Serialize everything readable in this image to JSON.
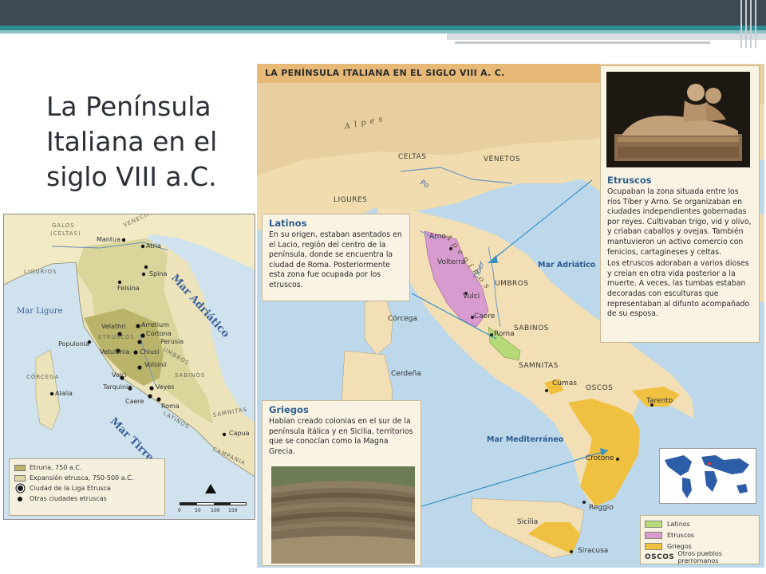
{
  "slide": {
    "title": "La Península Italiana en el siglo VIII a.C."
  },
  "colors": {
    "header_bar": "#3d4a55",
    "accent_teal": "#2f8c93",
    "title_text": "#2b3036"
  },
  "left_map": {
    "seas": {
      "adriatic": "Mar Adriático",
      "tyrrhenian": "Mar Tirreno",
      "ligurian": "Mar Ligure"
    },
    "peoples": {
      "galos": "GALOS",
      "celtas": "(CELTAS)",
      "venecianos": "VENECIANOS",
      "ligurios": "LIGURIOS",
      "etruscos": "ETRUSCOS",
      "umbros": "UMBROS",
      "sabinos": "SABINOS",
      "latinos": "LATINOS",
      "samnitas": "SAMNITAS",
      "campania": "CAMPANIA",
      "corcega": "CÓRCEGA"
    },
    "cities": {
      "mantua": "Mantua",
      "atria": "Atria",
      "spina": "Spina",
      "felsina": "Felsina",
      "arretium": "Arretium",
      "velathri": "Velathri",
      "cortona": "Cortona",
      "perusia": "Perusia",
      "populonia": "Populonia",
      "vetulonia": "Vetulonia",
      "chiusi": "Chiusi",
      "volsinii": "Volsinii",
      "volci": "Volci",
      "tarquinia": "Tarquinia",
      "veyes": "Veyes",
      "caere": "Caere",
      "roma": "Roma",
      "alalia": "Alalia",
      "capua": "Capua"
    },
    "legend": [
      {
        "label": "Etruria, 750 a.C.",
        "color": "#b9b46a"
      },
      {
        "label": "Expansión etrusca, 750-500 a.C.",
        "color": "#dcd9a0"
      },
      {
        "label": "Ciudad de la Liga Etrusca"
      },
      {
        "label": "Otras ciudades etruscas"
      }
    ],
    "scale_ticks": [
      "0",
      "50",
      "100",
      "150"
    ]
  },
  "big_map": {
    "title": "LA PENÍNSULA ITALIANA EN EL SIGLO VIII A. C.",
    "alps": "A l p e s",
    "apeninos": "A p e n i n o s",
    "rivers": {
      "po": "Po",
      "tiber": "Tíber"
    },
    "seas": {
      "adriatic": "Mar Adriático",
      "mediterranean": "Mar Mediterráneo"
    },
    "peoples": {
      "celtas": "CELTAS",
      "venetos": "VÉNETOS",
      "ligures": "LIGURES",
      "umbros": "UMBROS",
      "sabinos": "SABINOS",
      "samnitas": "SAMNITAS",
      "oscos": "OSCOS"
    },
    "places": {
      "arno": "Arno",
      "volterra": "Volterra",
      "vulci": "Vulci",
      "caere": "Caere",
      "roma": "Roma",
      "corcega": "Córcega",
      "cerdena": "Cerdeña",
      "cumas": "Cumas",
      "tarento": "Tarento",
      "crotone": "Crotone",
      "reggio": "Reggio",
      "sicilia": "Sicilia",
      "siracusa": "Siracusa"
    },
    "latinos_box": {
      "heading": "Latinos",
      "text": "En su origen, estaban asentados en el Lacio, región del centro de la península, donde se encuentra la ciudad de Roma. Posteriormente esta zona fue ocupada por los etruscos."
    },
    "etruscos_box": {
      "heading": "Etruscos",
      "text1": "Ocupaban la zona situada entre los ríos Tíber y Arno. Se organizaban en ciudades independientes gobernadas por reyes. Cultivaban trigo, vid y olivo, y criaban caballos y ovejas. También mantuvieron un activo comercio con fenicios, cartagineses y celtas.",
      "text2": "Los etruscos adoraban a varios dioses y creían en otra vida posterior a la muerte. A veces, las tumbas estaban decoradas con esculturas que representaban al difunto acompañado de su esposa."
    },
    "griegos_box": {
      "heading": "Griegos",
      "text": "Habían creado colonias en el sur de la península itálica y en Sicilia, territorios que se conocían como la Magna Grecia."
    },
    "legend": [
      {
        "label": "Latinos",
        "color": "#b6d97a"
      },
      {
        "label": "Etruscos",
        "color": "#d79bd0"
      },
      {
        "label": "Griegos",
        "color": "#f0c040"
      },
      {
        "caps": "OSCOS",
        "label": "Otros pueblos prerromanos"
      }
    ]
  }
}
